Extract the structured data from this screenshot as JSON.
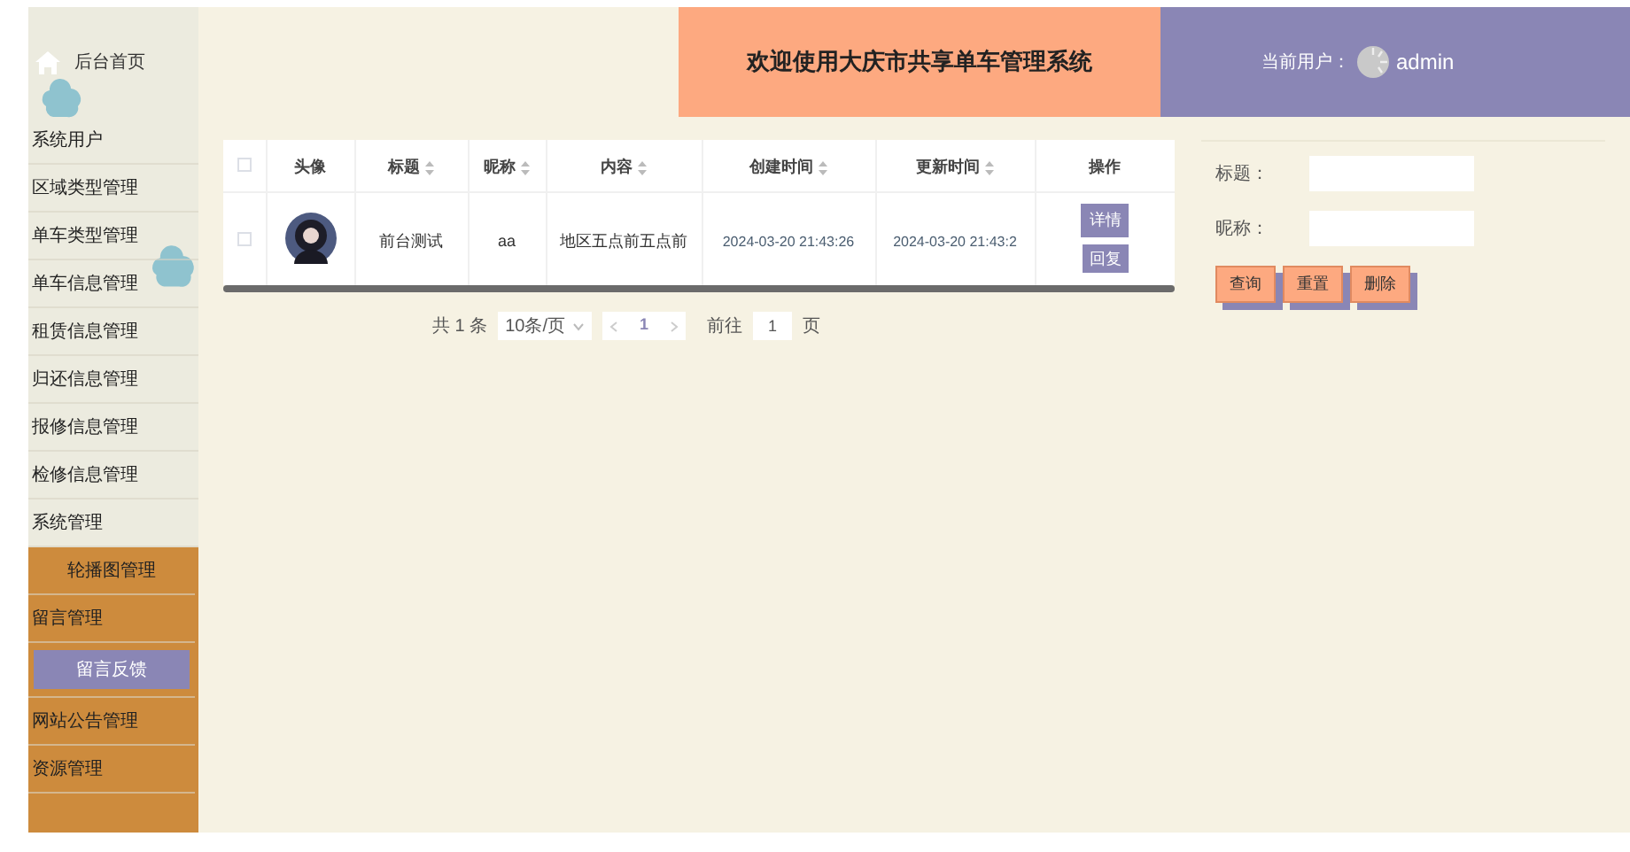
{
  "header": {
    "title": "欢迎使用大庆市共享单车管理系统",
    "user_label": "当前用户：",
    "user_name": "admin"
  },
  "sidebar": {
    "home_label": "后台首页",
    "menu": [
      {
        "label": "系统用户",
        "kind": "item",
        "selected": false
      },
      {
        "label": "区域类型管理",
        "kind": "item",
        "selected": false
      },
      {
        "label": "单车类型管理",
        "kind": "item",
        "selected": false
      },
      {
        "label": "单车信息管理",
        "kind": "item",
        "selected": false
      },
      {
        "label": "租赁信息管理",
        "kind": "item",
        "selected": false
      },
      {
        "label": "归还信息管理",
        "kind": "item",
        "selected": false
      },
      {
        "label": "报修信息管理",
        "kind": "item",
        "selected": false
      },
      {
        "label": "检修信息管理",
        "kind": "item",
        "selected": false
      },
      {
        "label": "系统管理",
        "kind": "item",
        "selected": false
      }
    ],
    "menu_lower": [
      {
        "label": "轮播图管理",
        "kind": "subitem",
        "selected": false
      },
      {
        "label": "留言管理",
        "kind": "item",
        "selected": false
      },
      {
        "label": "留言反馈",
        "kind": "subitem",
        "selected": true
      },
      {
        "label": "网站公告管理",
        "kind": "item",
        "selected": false
      },
      {
        "label": "资源管理",
        "kind": "item",
        "selected": false
      }
    ]
  },
  "table": {
    "columns": [
      {
        "kind": "checkbox",
        "checked": false
      },
      {
        "kind": "text",
        "label": "头像",
        "sortable": false
      },
      {
        "kind": "text",
        "label": "标题",
        "sortable": true
      },
      {
        "kind": "text",
        "label": "昵称",
        "sortable": true
      },
      {
        "kind": "text",
        "label": "内容",
        "sortable": true
      },
      {
        "kind": "text",
        "label": "创建时间",
        "sortable": true
      },
      {
        "kind": "text",
        "label": "更新时间",
        "sortable": true
      },
      {
        "kind": "text",
        "label": "操作",
        "sortable": false
      }
    ],
    "rows": [
      {
        "checked": false,
        "avatar": {
          "kind": "picture"
        },
        "title": "前台测试",
        "nickname": "aa",
        "content": "地区五点前五点前",
        "created": "2024-03-20 21:43:26",
        "updated": "2024-03-20 21:43:2",
        "actions": [
          "详情",
          "回复"
        ]
      }
    ]
  },
  "pagination": {
    "total": "共 1 条",
    "page_size": "10条/页",
    "pages": [
      {
        "label": "1",
        "selected": true
      }
    ],
    "goto_label": "前往",
    "goto_value": "1",
    "goto_suffix": "页"
  },
  "search": {
    "fields": [
      {
        "label": "标题："
      },
      {
        "label": "昵称："
      }
    ],
    "buttons": [
      "查询",
      "重置",
      "删除"
    ]
  }
}
